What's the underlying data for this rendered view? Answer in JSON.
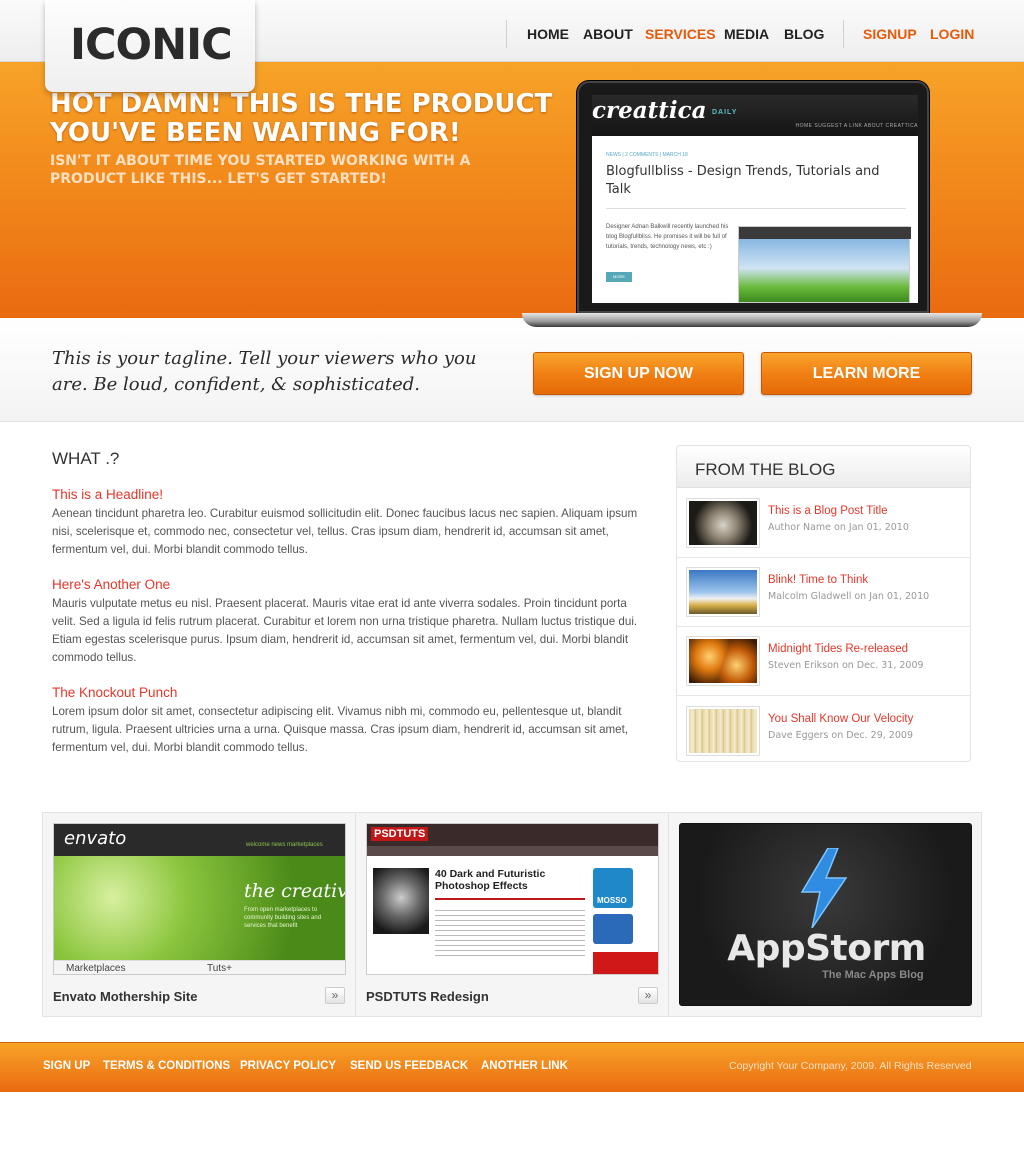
{
  "header": {
    "logo": "ICONIC",
    "nav": [
      "HOME",
      "ABOUT",
      "SERVICES",
      "MEDIA",
      "BLOG"
    ],
    "auth": [
      "SIGNUP",
      "LOGIN"
    ]
  },
  "hero": {
    "headline": "HOT DAMN! THIS IS THE PRODUCT YOU'VE BEEN WAITING FOR!",
    "subline": "ISN'T IT ABOUT TIME YOU STARTED WORKING WITH A PRODUCT LIKE THIS... LET'S GET STARTED!",
    "screen": {
      "logo": "creattica",
      "daily": "DAILY",
      "nav": "HOME   SUGGEST A LINK   ABOUT CREATTICA",
      "meta": "NEWS  |  2 COMMENTS  |  MARCH 18",
      "title": "Blogfullbliss - Design Trends, Tutorials and Talk",
      "excerpt": "Designer Adnan Balkwill recently launched his blog Blogfullbliss. He promises it will be full of tutorials, trends, technology news, etc :)",
      "more": "MORE"
    }
  },
  "tagline": {
    "text": "This is your tagline. Tell your viewers who you are. Be loud, confident, & sophisticated.",
    "signup_button": "SIGN UP NOW",
    "learn_button": "LEARN MORE"
  },
  "what": {
    "title": "WHAT .?",
    "articles": [
      {
        "headline": "This is a Headline!",
        "body": "Aenean tincidunt pharetra leo. Curabitur euismod sollicitudin elit. Donec faucibus lacus nec sapien. Aliquam ipsum nisi, scelerisque et, commodo nec, consectetur vel, tellus. Cras ipsum diam, hendrerit id, accumsan sit amet, fermentum vel, dui. Morbi blandit commodo tellus."
      },
      {
        "headline": "Here's Another One",
        "body": "Mauris vulputate metus eu nisl. Praesent placerat. Mauris vitae erat id ante viverra sodales. Proin tincidunt porta velit. Sed a ligula id felis rutrum placerat. Curabitur et lorem non urna tristique pharetra. Nullam luctus tristique dui. Etiam egestas scelerisque purus. Ipsum diam, hendrerit id, accumsan sit amet, fermentum vel, dui. Morbi blandit commodo tellus."
      },
      {
        "headline": "The Knockout Punch",
        "body": "Lorem ipsum dolor sit amet, consectetur adipiscing elit. Vivamus nibh mi, commodo eu, pellentesque ut, blandit rutrum, ligula. Praesent ultricies urna a urna. Quisque massa. Cras ipsum diam, hendrerit id, accumsan sit amet, fermentum vel, dui. Morbi blandit commodo tellus."
      }
    ]
  },
  "blog": {
    "title": "FROM THE BLOG",
    "posts": [
      {
        "title": "This is a Blog Post Title",
        "meta": "Author Name on Jan 01, 2010"
      },
      {
        "title": "Blink! Time to Think",
        "meta": "Malcolm Gladwell on Jan 01, 2010"
      },
      {
        "title": "Midnight Tides Re-released",
        "meta": "Steven Erikson on Dec. 31, 2009"
      },
      {
        "title": "You Shall Know Our Velocity",
        "meta": "Dave Eggers on Dec. 29, 2009"
      }
    ]
  },
  "portfolio": [
    {
      "label": "Envato Mothership Site",
      "shot": {
        "logo": "envato",
        "nav": "welcome   news   marketplaces",
        "tagline": "the creative",
        "blurb": "From open marketplaces to community building sites and services that benefit",
        "tab1": "Marketplaces",
        "tab2": "Tuts+"
      }
    },
    {
      "label": "PSDTUTS Redesign",
      "shot": {
        "logo": "PSDTUTS",
        "headline": "40 Dark and Futuristic Photoshop Effects",
        "badge": "MOSSO"
      }
    },
    {
      "label": "",
      "shot": {
        "title": "AppStorm",
        "subtitle": "The Mac Apps Blog"
      }
    }
  ],
  "footer": {
    "links": [
      "SIGN UP",
      "TERMS & CONDITIONS",
      "PRIVACY POLICY",
      "SEND US FEEDBACK",
      "ANOTHER LINK"
    ],
    "copyright": "Copyright Your Company, 2009. All Rights Reserved"
  }
}
